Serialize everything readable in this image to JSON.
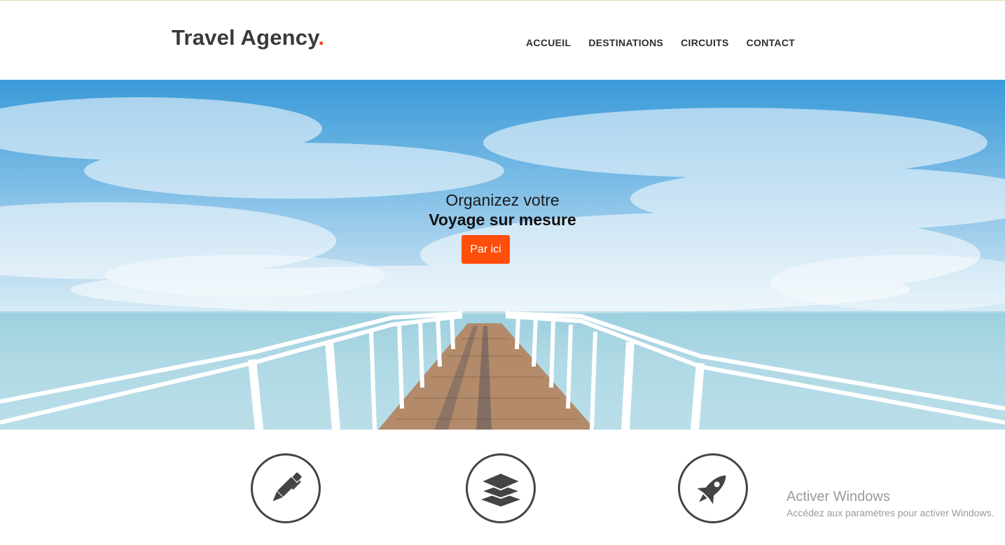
{
  "header": {
    "logo_text": "Travel Agency",
    "logo_dot": ".",
    "nav": [
      {
        "label": "ACCUEIL"
      },
      {
        "label": "DESTINATIONS"
      },
      {
        "label": "CIRCUITS"
      },
      {
        "label": "CONTACT"
      }
    ]
  },
  "hero": {
    "line1": "Organizez votre",
    "line2": "Voyage sur mesure",
    "cta_label": "Par ici"
  },
  "features": [
    {
      "icon": "pen-icon"
    },
    {
      "icon": "layers-icon"
    },
    {
      "icon": "rocket-icon"
    }
  ],
  "watermark": {
    "title": "Activer Windows",
    "subtitle": "Accédez aux paramètres pour activer Windows."
  },
  "colors": {
    "accent": "#ff4d0a",
    "logo_dot": "#e8452c",
    "text_dark": "#3a3a3a"
  }
}
